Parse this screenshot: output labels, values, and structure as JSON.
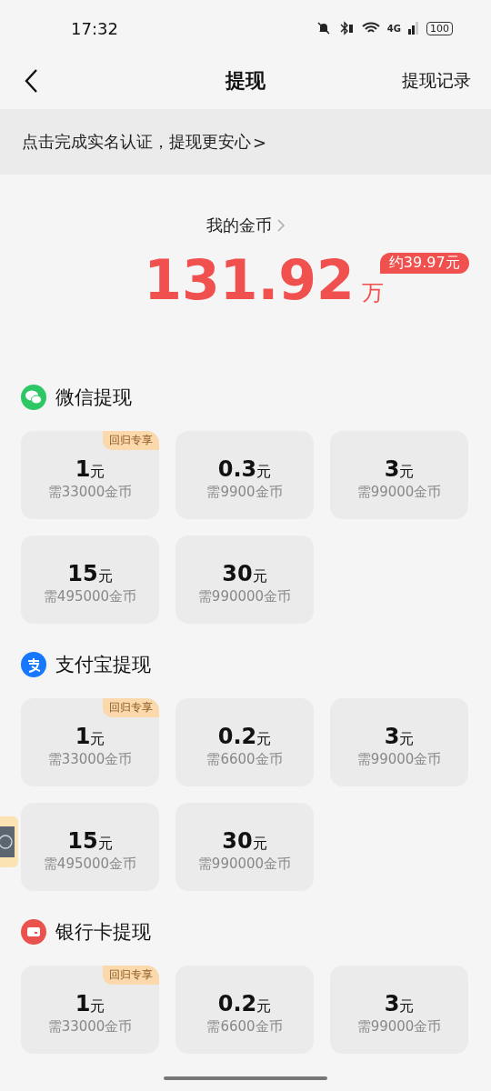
{
  "status_bar": {
    "time": "17:32",
    "battery": "100",
    "network": "4G"
  },
  "nav": {
    "title": "提现",
    "action": "提现记录"
  },
  "banner": {
    "text": "点击完成实名认证，提现更安心",
    "arrow": ">"
  },
  "coins": {
    "label": "我的金币",
    "amount": "131.92",
    "unit": "万",
    "approx": "约39.97元"
  },
  "sections": [
    {
      "kind": "wechat",
      "title": "微信提现",
      "options": [
        {
          "amount": "1",
          "unit": "元",
          "cost": "需33000金币",
          "badge": "回归专享"
        },
        {
          "amount": "0.3",
          "unit": "元",
          "cost": "需9900金币"
        },
        {
          "amount": "3",
          "unit": "元",
          "cost": "需99000金币"
        },
        {
          "amount": "15",
          "unit": "元",
          "cost": "需495000金币"
        },
        {
          "amount": "30",
          "unit": "元",
          "cost": "需990000金币"
        }
      ]
    },
    {
      "kind": "alipay",
      "title": "支付宝提现",
      "options": [
        {
          "amount": "1",
          "unit": "元",
          "cost": "需33000金币",
          "badge": "回归专享"
        },
        {
          "amount": "0.2",
          "unit": "元",
          "cost": "需6600金币"
        },
        {
          "amount": "3",
          "unit": "元",
          "cost": "需99000金币"
        },
        {
          "amount": "15",
          "unit": "元",
          "cost": "需495000金币"
        },
        {
          "amount": "30",
          "unit": "元",
          "cost": "需990000金币"
        }
      ]
    },
    {
      "kind": "bank",
      "title": "银行卡提现",
      "options": [
        {
          "amount": "1",
          "unit": "元",
          "cost": "需33000金币",
          "badge": "回归专享"
        },
        {
          "amount": "0.2",
          "unit": "元",
          "cost": "需6600金币"
        },
        {
          "amount": "3",
          "unit": "元",
          "cost": "需99000金币"
        }
      ]
    }
  ]
}
